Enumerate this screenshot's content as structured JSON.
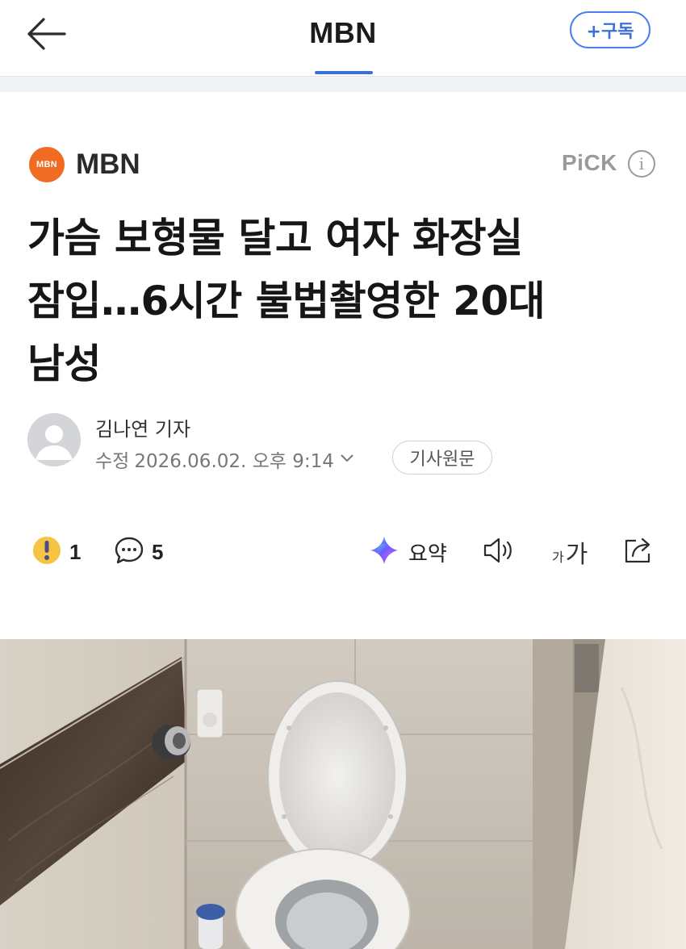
{
  "nav": {
    "title": "MBN",
    "subscribe_label": "+구독"
  },
  "press": {
    "logo_text": "MBN",
    "name": "MBN",
    "pick_label": "PiCK",
    "info_label": "i",
    "logo_color": "#f26b22"
  },
  "article": {
    "headline_lines": [
      "가슴 보형물 달고 여자 화장실",
      "잠입…6시간 불법촬영한 20대",
      "남성"
    ],
    "reporter": "김나연 기자",
    "modified_label": "수정",
    "modified_datetime": "2026.06.02. 오후 9:14",
    "origin_button": "기사원문"
  },
  "actions": {
    "reaction_count": "1",
    "comment_count": "5",
    "summary_label": "요약",
    "font_size_label_small": "가",
    "font_size_label_large": "가"
  },
  "colors": {
    "accent": "#3b6fd8",
    "press_orange": "#f26b22",
    "reaction_yellow": "#f6c443"
  },
  "icons": [
    "back-arrow-icon",
    "info-icon",
    "avatar-icon",
    "reaction-icon",
    "comment-icon",
    "ai-summary-icon",
    "speaker-icon",
    "font-size-icon",
    "share-icon"
  ]
}
